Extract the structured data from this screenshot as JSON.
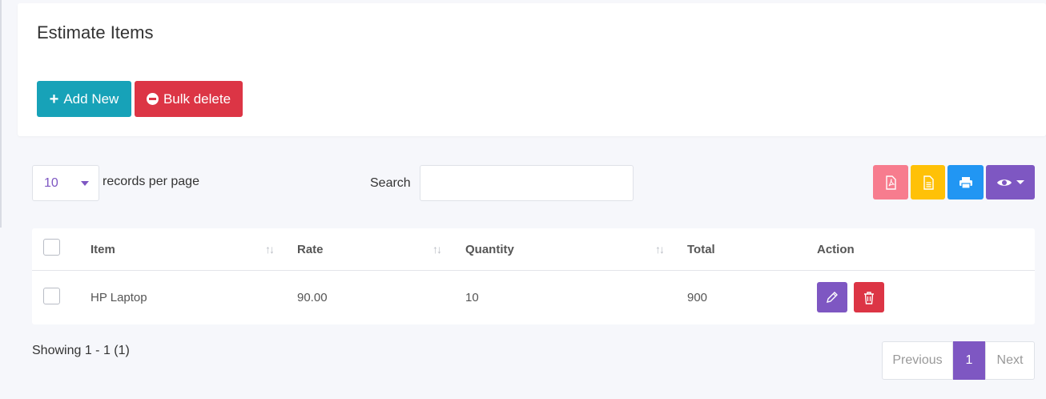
{
  "card": {
    "title": "Estimate Items"
  },
  "actions": {
    "add_label": "Add New",
    "bulk_label": "Bulk delete"
  },
  "controls": {
    "per_page_value": "10",
    "per_page_label": "records per page",
    "search_label": "Search",
    "search_value": ""
  },
  "toolbar": {
    "icons": [
      "pdf-icon",
      "csv-icon",
      "print-icon",
      "eye-icon"
    ],
    "colors": {
      "pdf": "#f77c8e",
      "csv": "#ffc107",
      "print": "#2196f3",
      "view": "#7e57c2"
    }
  },
  "table": {
    "columns": [
      "Item",
      "Rate",
      "Quantity",
      "Total",
      "Action"
    ],
    "rows": [
      {
        "item": "HP Laptop",
        "rate": "90.00",
        "quantity": "10",
        "total": "900"
      }
    ]
  },
  "footer": {
    "showing": "Showing 1 - 1 (1)",
    "prev": "Previous",
    "page": "1",
    "next": "Next"
  },
  "colors": {
    "accent": "#7e57c2",
    "info": "#17a2b8",
    "danger": "#dc3545"
  }
}
